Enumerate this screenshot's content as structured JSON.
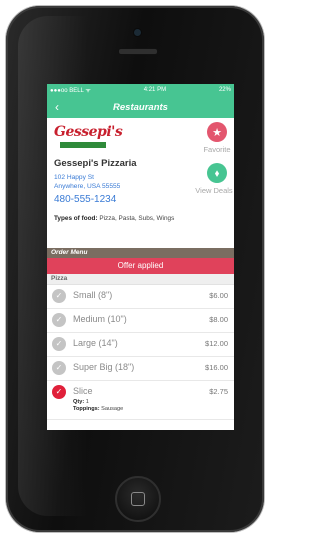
{
  "status_bar": {
    "carrier": "●●●oo BELL ᯤ",
    "time": "4:21 PM",
    "battery": "22%"
  },
  "nav": {
    "back_icon": "‹",
    "title": "Restaurants"
  },
  "restaurant": {
    "logo_text": "Gessepi's",
    "name": "Gessepi's Pizzaria",
    "address_line1": "102 Happy St",
    "address_line2": "Anywhere, USA 55555",
    "phone": "480-555-1234",
    "food_label": "Types of food:",
    "food_types": " Pizza, Pasta, Subs, Wings"
  },
  "actions": {
    "favorite_label": "Favorite",
    "view_deals_label": "View Deals"
  },
  "order_menu": {
    "header": "Order Menu",
    "offer": "Offer applied",
    "category": "Pizza",
    "items": [
      {
        "name": "Small (8\")",
        "price": "$6.00",
        "selected": false
      },
      {
        "name": "Medium (10\")",
        "price": "$8.00",
        "selected": false
      },
      {
        "name": "Large (14\")",
        "price": "$12.00",
        "selected": false
      },
      {
        "name": "Super Big (18\")",
        "price": "$16.00",
        "selected": false
      },
      {
        "name": "Slice",
        "price": "$2.75",
        "selected": true,
        "qty_label": "Qty:",
        "qty": " 1",
        "toppings_label": "Toppings:",
        "toppings": " Sausage"
      }
    ]
  },
  "colors": {
    "accent_green": "#47c592",
    "offer_red": "#e0425b",
    "link_blue": "#3a7bd5"
  },
  "icons": {
    "favorite": "star-icon",
    "deals": "tag-icon",
    "check": "check-icon"
  }
}
